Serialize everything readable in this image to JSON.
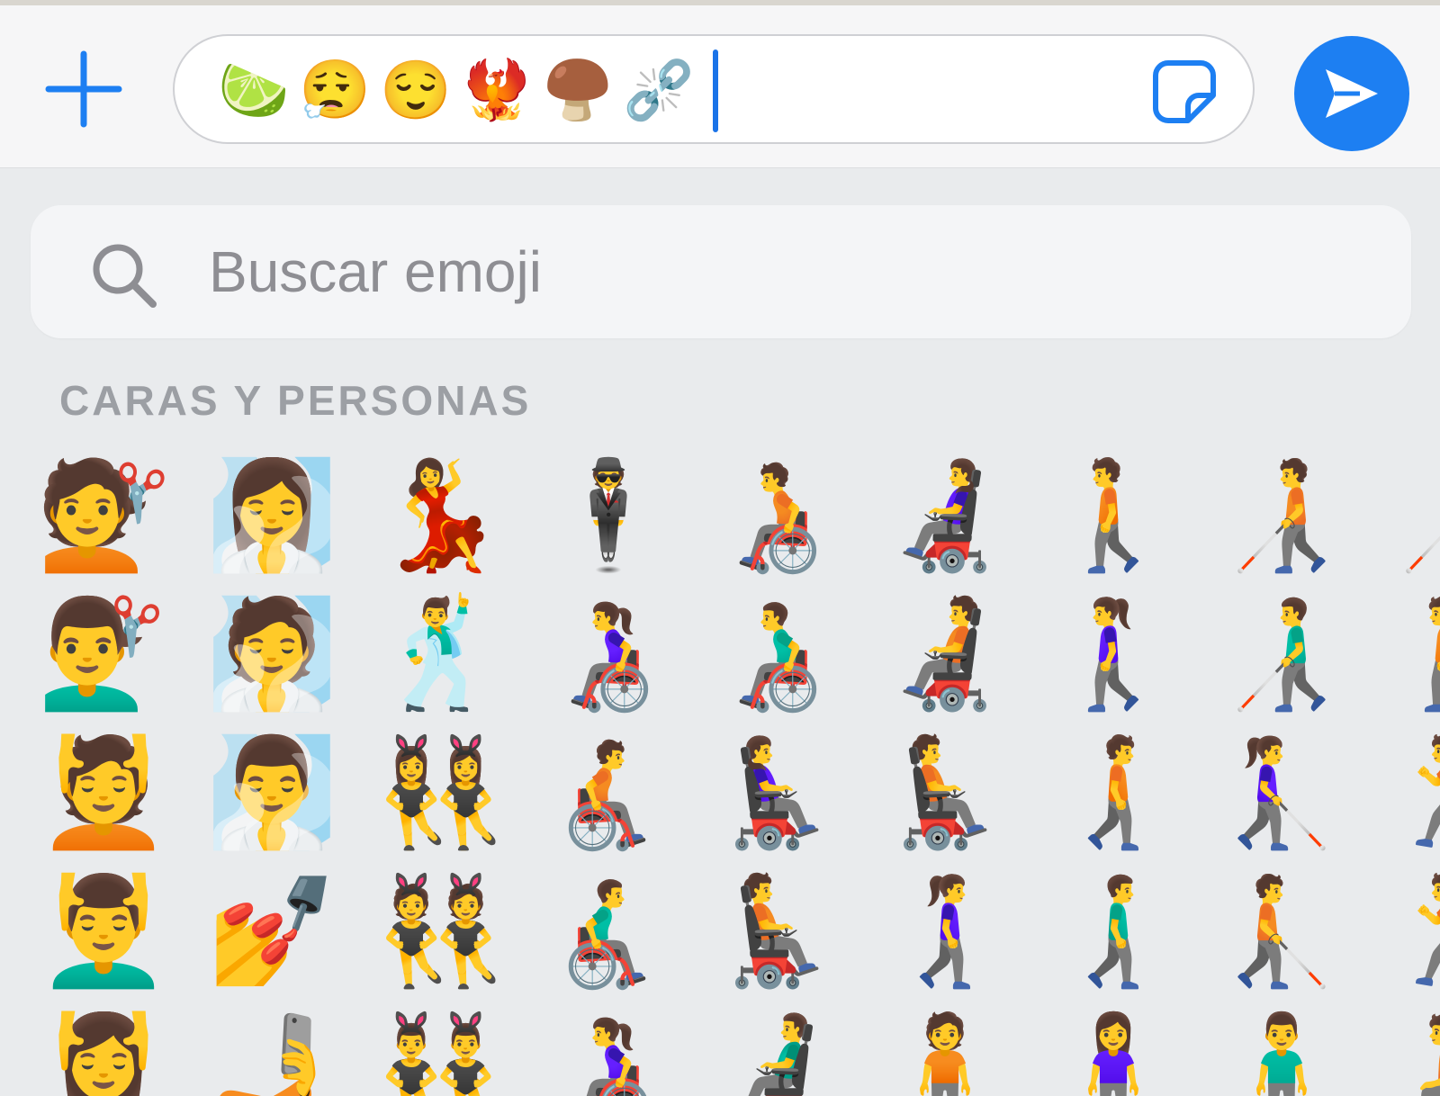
{
  "compose": {
    "typed_emojis": [
      "🍋‍🟩",
      "😮‍💨",
      "😌",
      "🐦‍🔥",
      "🍄‍🟫",
      "⛓️‍💥"
    ]
  },
  "search": {
    "placeholder": "Buscar emoji"
  },
  "section": {
    "title": "CARAS Y PERSONAS"
  },
  "emoji_rows": [
    [
      "💇",
      "🧖‍♀️",
      "💃",
      "🕴️",
      "🧑‍🦽",
      "👩‍🦼",
      "🚶",
      "🧑‍🦯",
      "🧑‍🦯"
    ],
    [
      "💇‍♂️",
      "🧖",
      "🕺",
      "👩‍🦽",
      "👨‍🦽",
      "🧑‍🦼",
      "🚶‍♀️",
      "👨‍🦯",
      "🚶"
    ],
    [
      "💆",
      "🧖‍♂️",
      "👯‍♀️",
      "🧑‍🦽‍➡️",
      "👩‍🦼‍➡️",
      "🧑‍🦼‍➡️",
      "🚶‍➡️",
      "👩‍🦯‍➡️",
      "🏃"
    ],
    [
      "💆‍♂️",
      "💅",
      "👯",
      "👨‍🦽‍➡️",
      "🧑‍🦼‍➡️",
      "🚶‍♀️‍➡️",
      "🚶‍♂️‍➡️",
      "🧑‍🦯‍➡️",
      "🏃"
    ],
    [
      "💆‍♀️",
      "🤳",
      "👯‍♂️",
      "👩‍🦽",
      "👨‍🦼",
      "🧍",
      "🧍‍♀️",
      "🧍‍♂️",
      "🧎"
    ]
  ],
  "colors": {
    "accent": "#1d7ff2",
    "background": "#e9ebed",
    "section_title": "#9c9fa4",
    "placeholder": "#8e8e93"
  },
  "icons": {
    "add": "plus-icon",
    "sticker": "sticker-icon",
    "send": "send-icon",
    "search": "search-icon"
  }
}
